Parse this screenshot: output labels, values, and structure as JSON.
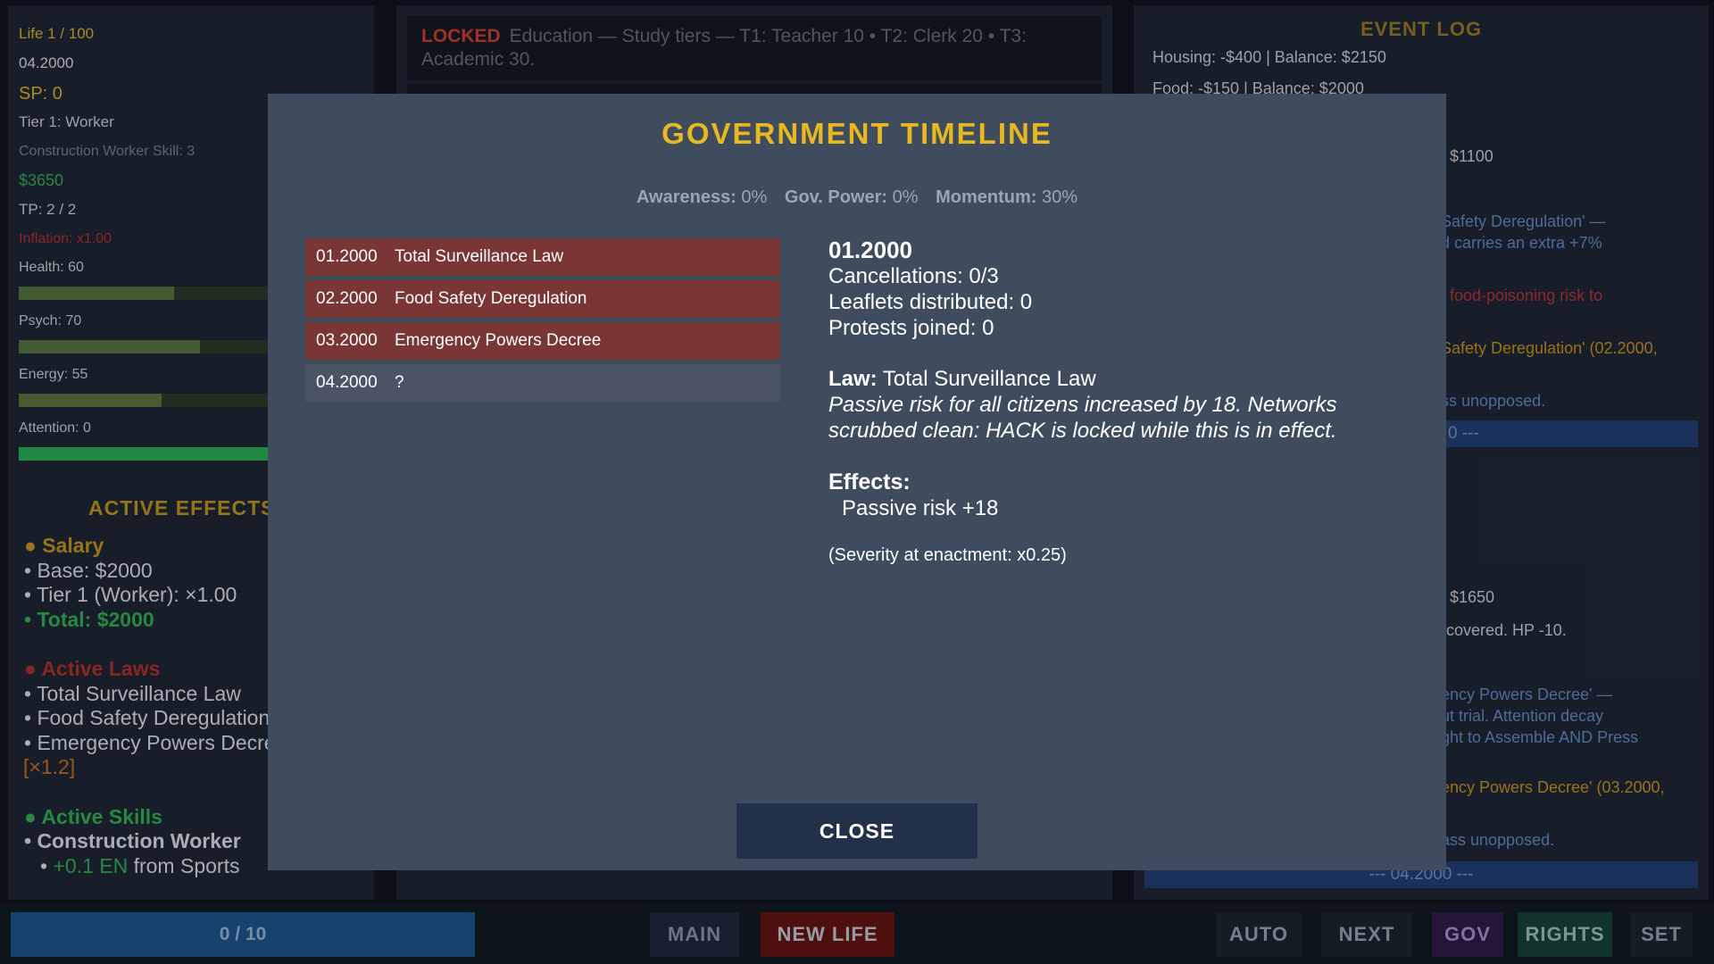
{
  "left": {
    "life": "Life 1 / 100",
    "date": "04.2000",
    "sp": "SP: 0",
    "tier": "Tier 1: Worker",
    "job": "Construction Worker  Skill: 3",
    "money": "$3650",
    "tp": "TP: 2 / 2",
    "inflation": "Inflation: x1.00",
    "health_label": "Health: 60",
    "psych_label": "Psych: 70",
    "energy_label": "Energy: 55",
    "attention_label": "Attention: 0",
    "effects_title": "ACTIVE EFFECTS",
    "salary_head": "● Salary",
    "salary_base": "• Base: $2000",
    "salary_tier": "• Tier 1 (Worker): ×1.00",
    "salary_total": "• Total: $2000",
    "laws_head": "● Active Laws",
    "laws": [
      "• Total Surveillance Law",
      "• Food Safety Deregulation",
      "• Emergency Powers Decree"
    ],
    "laws_mult": "[×1.2]",
    "skills_head": "● Active Skills",
    "skill_name": "• Construction Worker",
    "skill_bonus_value": "+0.1 EN",
    "skill_bonus_text": "from Sports"
  },
  "center": {
    "locked_tag": "LOCKED",
    "locked_text": "Education — Study tiers — T1: Teacher 10  •  T2: Clerk 20  •  T3: Academic 30."
  },
  "log": {
    "title": "EVENT LOG",
    "housing": "Housing: -$400  |  Balance: $2150",
    "food": "Food: -$150  |  Balance: $2000",
    "l1100": "$1100",
    "l_fsd1": "Safety Deregulation' —",
    "l_fsd2": "d carries an extra +7%",
    "l_food": "food-poisoning risk to",
    "l_fsd3": "Safety Deregulation' (02.2000,",
    "l_unopp1": "ss unopposed.",
    "band1": "0 ---",
    "l1650": "$1650",
    "l_covered": "covered. HP -10.",
    "l_epd1": "ency Powers Decree' —",
    "l_epd2": "ut trial. Attention decay",
    "l_epd3": "ght to Assemble AND Press",
    "l_epd4": "ency Powers Decree' (03.2000,",
    "l_unopp2": "ass unopposed.",
    "band2": "--- 04.2000 ---"
  },
  "bottom": {
    "progress": "0 / 10",
    "main": "MAIN",
    "new_life": "NEW LIFE",
    "auto": "AUTO",
    "next": "NEXT",
    "gov": "GOV",
    "rights": "RIGHTS",
    "set": "SET"
  },
  "modal": {
    "title": "GOVERNMENT TIMELINE",
    "awareness_label": "Awareness:",
    "awareness_value": "0%",
    "gov_power_label": "Gov. Power:",
    "gov_power_value": "0%",
    "momentum_label": "Momentum:",
    "momentum_value": "30%",
    "timeline": [
      {
        "date": "01.2000",
        "name": "Total Surveillance Law"
      },
      {
        "date": "02.2000",
        "name": "Food Safety Deregulation"
      },
      {
        "date": "03.2000",
        "name": "Emergency Powers Decree"
      },
      {
        "date": "04.2000",
        "name": "?"
      }
    ],
    "detail": {
      "date": "01.2000",
      "cancellations": "Cancellations: 0/3",
      "leaflets": "Leaflets distributed: 0",
      "protests": "Protests joined: 0",
      "law_label": "Law:",
      "law_name": "Total Surveillance Law",
      "desc": "Passive risk for all citizens increased by 18. Networks scrubbed clean: HACK is locked while this is in effect.",
      "effects_label": "Effects:",
      "effect": "Passive risk +18",
      "severity": "(Severity at enactment: x0.25)"
    },
    "close": "CLOSE"
  },
  "colors": {
    "accent_gold": "#e8b820",
    "law_red": "#7a3535",
    "health_fill": "#4e6a3a",
    "attention_fill": "#27a04f"
  },
  "stats": {
    "health": 60,
    "psych": 70,
    "energy": 55,
    "attention": 0
  }
}
